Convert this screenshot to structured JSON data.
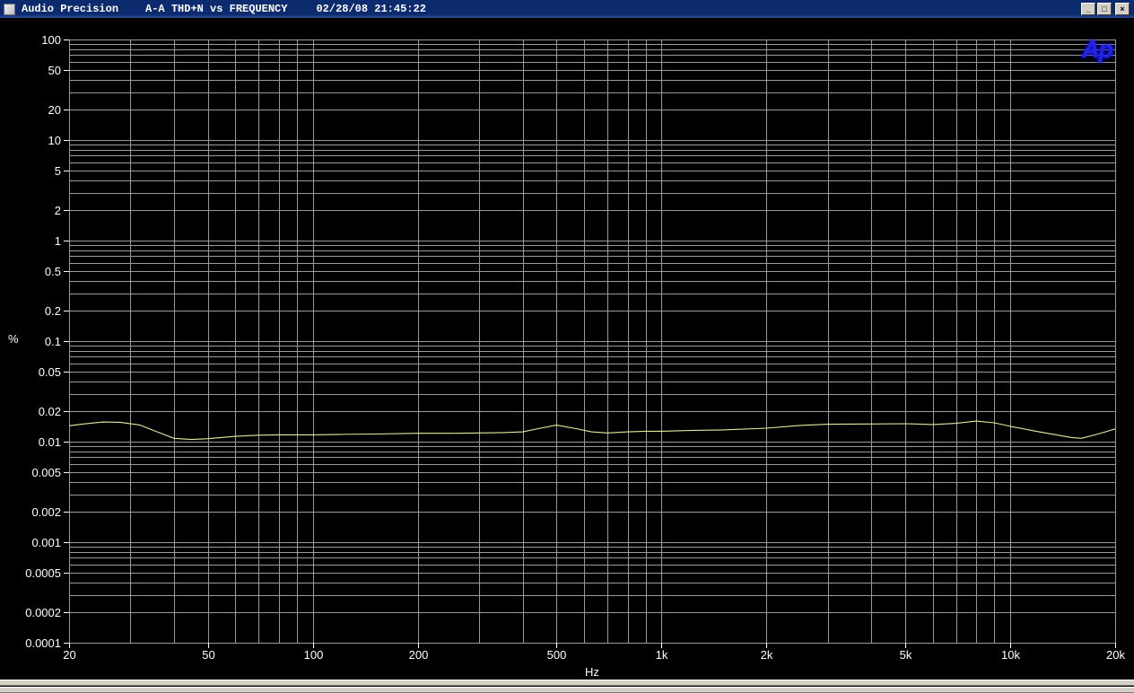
{
  "window": {
    "title_app": "Audio Precision",
    "title_doc": "A-A THD+N vs FREQUENCY",
    "title_time": "02/28/08 21:45:22",
    "buttons": {
      "minimize": "_",
      "maximize": "□",
      "close": "×"
    }
  },
  "chart_data": {
    "type": "line",
    "title": "A-A THD+N vs FREQUENCY",
    "xlabel": "Hz",
    "ylabel": "%",
    "x_scale": "log",
    "y_scale": "log",
    "xlim": [
      20,
      20000
    ],
    "ylim": [
      0.0001,
      100
    ],
    "grid": true,
    "legend": "none",
    "logo": "Ap",
    "x_ticks": [
      {
        "v": 20,
        "label": "20"
      },
      {
        "v": 50,
        "label": "50"
      },
      {
        "v": 100,
        "label": "100"
      },
      {
        "v": 200,
        "label": "200"
      },
      {
        "v": 500,
        "label": "500"
      },
      {
        "v": 1000,
        "label": "1k"
      },
      {
        "v": 2000,
        "label": "2k"
      },
      {
        "v": 5000,
        "label": "5k"
      },
      {
        "v": 10000,
        "label": "10k"
      },
      {
        "v": 20000,
        "label": "20k"
      }
    ],
    "y_ticks": [
      {
        "v": 100,
        "label": "100"
      },
      {
        "v": 50,
        "label": "50"
      },
      {
        "v": 20,
        "label": "20"
      },
      {
        "v": 10,
        "label": "10"
      },
      {
        "v": 5,
        "label": "5"
      },
      {
        "v": 2,
        "label": "2"
      },
      {
        "v": 1,
        "label": "1"
      },
      {
        "v": 0.5,
        "label": "0.5"
      },
      {
        "v": 0.2,
        "label": "0.2"
      },
      {
        "v": 0.1,
        "label": "0.1"
      },
      {
        "v": 0.05,
        "label": "0.05"
      },
      {
        "v": 0.02,
        "label": "0.02"
      },
      {
        "v": 0.01,
        "label": "0.01"
      },
      {
        "v": 0.005,
        "label": "0.005"
      },
      {
        "v": 0.002,
        "label": "0.002"
      },
      {
        "v": 0.001,
        "label": "0.001"
      },
      {
        "v": 0.0005,
        "label": "0.0005"
      },
      {
        "v": 0.0002,
        "label": "0.0002"
      },
      {
        "v": 0.0001,
        "label": "0.0001"
      }
    ],
    "series": [
      {
        "name": "THD+N",
        "color": "#e8e8a0",
        "points": [
          [
            20,
            0.0144
          ],
          [
            22,
            0.015
          ],
          [
            25,
            0.0157
          ],
          [
            28,
            0.0156
          ],
          [
            32,
            0.0146
          ],
          [
            36,
            0.0124
          ],
          [
            40,
            0.0108
          ],
          [
            45,
            0.0105
          ],
          [
            50,
            0.0107
          ],
          [
            60,
            0.0113
          ],
          [
            70,
            0.0116
          ],
          [
            80,
            0.0117
          ],
          [
            100,
            0.0117
          ],
          [
            120,
            0.0118
          ],
          [
            150,
            0.0119
          ],
          [
            200,
            0.0121
          ],
          [
            250,
            0.0121
          ],
          [
            300,
            0.0122
          ],
          [
            350,
            0.0123
          ],
          [
            400,
            0.0125
          ],
          [
            450,
            0.0136
          ],
          [
            500,
            0.0146
          ],
          [
            560,
            0.0136
          ],
          [
            630,
            0.0125
          ],
          [
            700,
            0.0122
          ],
          [
            800,
            0.0125
          ],
          [
            900,
            0.0127
          ],
          [
            1000,
            0.0127
          ],
          [
            1200,
            0.0129
          ],
          [
            1500,
            0.0131
          ],
          [
            2000,
            0.0136
          ],
          [
            2500,
            0.0145
          ],
          [
            3000,
            0.0149
          ],
          [
            4000,
            0.015
          ],
          [
            5000,
            0.0151
          ],
          [
            6000,
            0.0148
          ],
          [
            7000,
            0.0152
          ],
          [
            8000,
            0.016
          ],
          [
            9000,
            0.0154
          ],
          [
            10000,
            0.0142
          ],
          [
            12000,
            0.0126
          ],
          [
            15000,
            0.011
          ],
          [
            16000,
            0.0108
          ],
          [
            18000,
            0.012
          ],
          [
            20000,
            0.0134
          ]
        ]
      }
    ]
  },
  "colors": {
    "titlebar": "#0c2a6e",
    "titlebar_text": "#ffffff",
    "plot_bg": "#000000",
    "grid": "#9a9a9a",
    "tick_text": "#ffffff",
    "trace": "#e8e8a0",
    "logo_blue": "#2323e6",
    "window_chrome": "#d4d0c8"
  }
}
